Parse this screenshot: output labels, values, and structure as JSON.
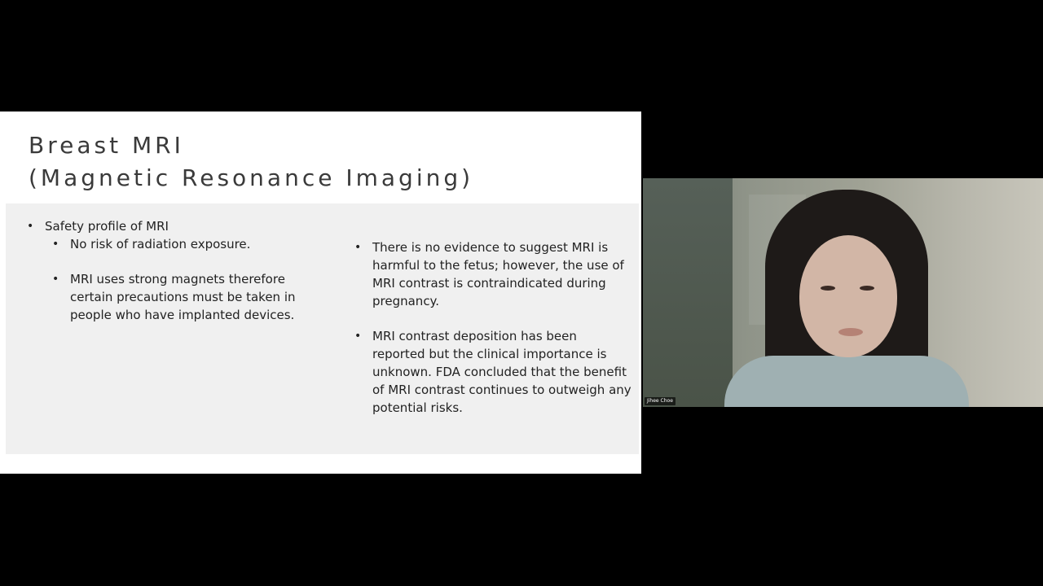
{
  "slide": {
    "title_line1": "Breast MRI",
    "title_line2": "(Magnetic Resonance Imaging)",
    "left_column": {
      "heading": "Safety profile of MRI",
      "sub_bullets": [
        "No risk of radiation exposure.",
        "MRI uses strong magnets therefore certain precautions must be taken in people who have implanted devices."
      ]
    },
    "right_column": {
      "bullets": [
        "There is no evidence to suggest MRI is harmful to the fetus; however, the use of MRI contrast is contraindicated during pregnancy.",
        "MRI contrast deposition has been reported but the clinical importance is unknown. FDA concluded that the benefit of MRI contrast continues to outweigh any potential risks."
      ]
    }
  },
  "video": {
    "participant_name": "Jihee Choe"
  }
}
